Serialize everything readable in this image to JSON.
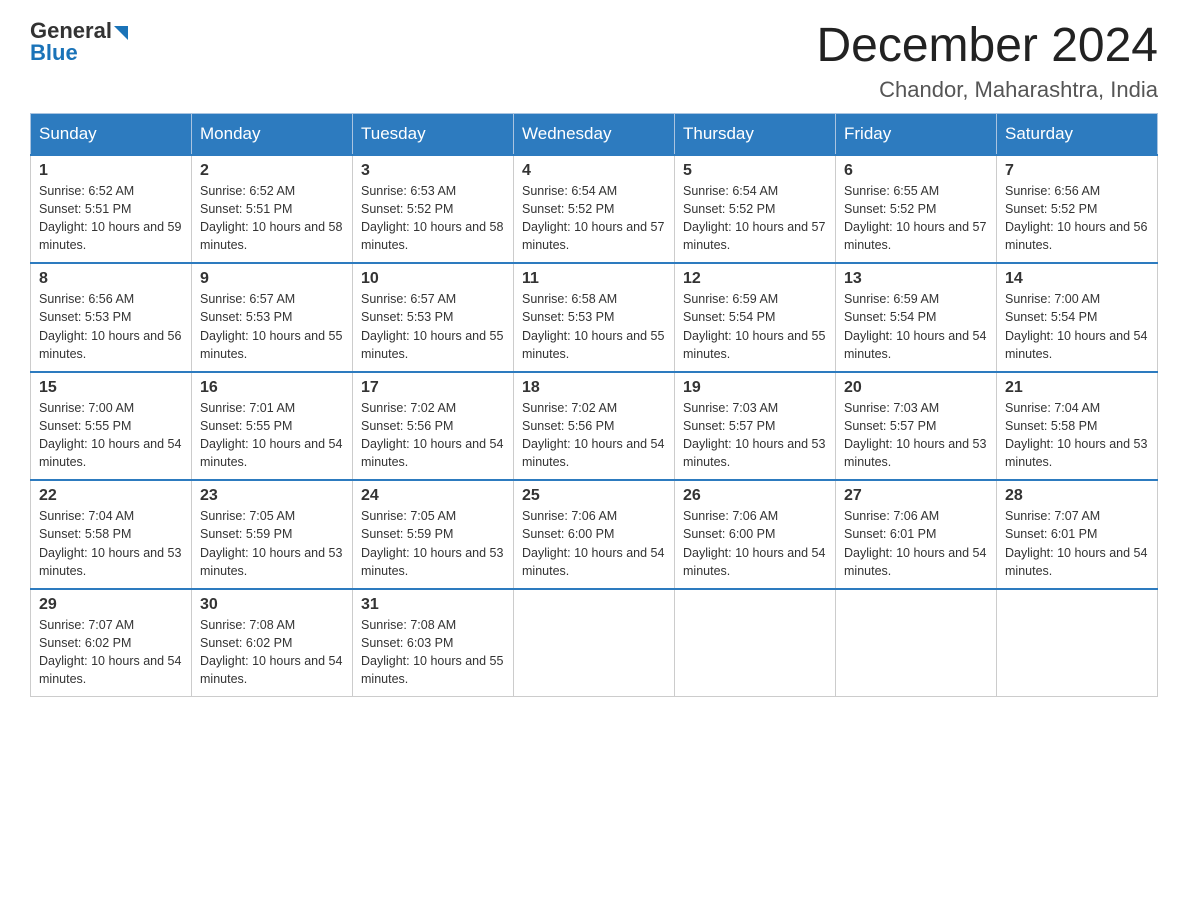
{
  "header": {
    "logo_general": "General",
    "logo_blue": "Blue",
    "title": "December 2024",
    "subtitle": "Chandor, Maharashtra, India"
  },
  "days_of_week": [
    "Sunday",
    "Monday",
    "Tuesday",
    "Wednesday",
    "Thursday",
    "Friday",
    "Saturday"
  ],
  "weeks": [
    [
      {
        "day": "1",
        "sunrise": "6:52 AM",
        "sunset": "5:51 PM",
        "daylight": "10 hours and 59 minutes."
      },
      {
        "day": "2",
        "sunrise": "6:52 AM",
        "sunset": "5:51 PM",
        "daylight": "10 hours and 58 minutes."
      },
      {
        "day": "3",
        "sunrise": "6:53 AM",
        "sunset": "5:52 PM",
        "daylight": "10 hours and 58 minutes."
      },
      {
        "day": "4",
        "sunrise": "6:54 AM",
        "sunset": "5:52 PM",
        "daylight": "10 hours and 57 minutes."
      },
      {
        "day": "5",
        "sunrise": "6:54 AM",
        "sunset": "5:52 PM",
        "daylight": "10 hours and 57 minutes."
      },
      {
        "day": "6",
        "sunrise": "6:55 AM",
        "sunset": "5:52 PM",
        "daylight": "10 hours and 57 minutes."
      },
      {
        "day": "7",
        "sunrise": "6:56 AM",
        "sunset": "5:52 PM",
        "daylight": "10 hours and 56 minutes."
      }
    ],
    [
      {
        "day": "8",
        "sunrise": "6:56 AM",
        "sunset": "5:53 PM",
        "daylight": "10 hours and 56 minutes."
      },
      {
        "day": "9",
        "sunrise": "6:57 AM",
        "sunset": "5:53 PM",
        "daylight": "10 hours and 55 minutes."
      },
      {
        "day": "10",
        "sunrise": "6:57 AM",
        "sunset": "5:53 PM",
        "daylight": "10 hours and 55 minutes."
      },
      {
        "day": "11",
        "sunrise": "6:58 AM",
        "sunset": "5:53 PM",
        "daylight": "10 hours and 55 minutes."
      },
      {
        "day": "12",
        "sunrise": "6:59 AM",
        "sunset": "5:54 PM",
        "daylight": "10 hours and 55 minutes."
      },
      {
        "day": "13",
        "sunrise": "6:59 AM",
        "sunset": "5:54 PM",
        "daylight": "10 hours and 54 minutes."
      },
      {
        "day": "14",
        "sunrise": "7:00 AM",
        "sunset": "5:54 PM",
        "daylight": "10 hours and 54 minutes."
      }
    ],
    [
      {
        "day": "15",
        "sunrise": "7:00 AM",
        "sunset": "5:55 PM",
        "daylight": "10 hours and 54 minutes."
      },
      {
        "day": "16",
        "sunrise": "7:01 AM",
        "sunset": "5:55 PM",
        "daylight": "10 hours and 54 minutes."
      },
      {
        "day": "17",
        "sunrise": "7:02 AM",
        "sunset": "5:56 PM",
        "daylight": "10 hours and 54 minutes."
      },
      {
        "day": "18",
        "sunrise": "7:02 AM",
        "sunset": "5:56 PM",
        "daylight": "10 hours and 54 minutes."
      },
      {
        "day": "19",
        "sunrise": "7:03 AM",
        "sunset": "5:57 PM",
        "daylight": "10 hours and 53 minutes."
      },
      {
        "day": "20",
        "sunrise": "7:03 AM",
        "sunset": "5:57 PM",
        "daylight": "10 hours and 53 minutes."
      },
      {
        "day": "21",
        "sunrise": "7:04 AM",
        "sunset": "5:58 PM",
        "daylight": "10 hours and 53 minutes."
      }
    ],
    [
      {
        "day": "22",
        "sunrise": "7:04 AM",
        "sunset": "5:58 PM",
        "daylight": "10 hours and 53 minutes."
      },
      {
        "day": "23",
        "sunrise": "7:05 AM",
        "sunset": "5:59 PM",
        "daylight": "10 hours and 53 minutes."
      },
      {
        "day": "24",
        "sunrise": "7:05 AM",
        "sunset": "5:59 PM",
        "daylight": "10 hours and 53 minutes."
      },
      {
        "day": "25",
        "sunrise": "7:06 AM",
        "sunset": "6:00 PM",
        "daylight": "10 hours and 54 minutes."
      },
      {
        "day": "26",
        "sunrise": "7:06 AM",
        "sunset": "6:00 PM",
        "daylight": "10 hours and 54 minutes."
      },
      {
        "day": "27",
        "sunrise": "7:06 AM",
        "sunset": "6:01 PM",
        "daylight": "10 hours and 54 minutes."
      },
      {
        "day": "28",
        "sunrise": "7:07 AM",
        "sunset": "6:01 PM",
        "daylight": "10 hours and 54 minutes."
      }
    ],
    [
      {
        "day": "29",
        "sunrise": "7:07 AM",
        "sunset": "6:02 PM",
        "daylight": "10 hours and 54 minutes."
      },
      {
        "day": "30",
        "sunrise": "7:08 AM",
        "sunset": "6:02 PM",
        "daylight": "10 hours and 54 minutes."
      },
      {
        "day": "31",
        "sunrise": "7:08 AM",
        "sunset": "6:03 PM",
        "daylight": "10 hours and 55 minutes."
      },
      null,
      null,
      null,
      null
    ]
  ]
}
